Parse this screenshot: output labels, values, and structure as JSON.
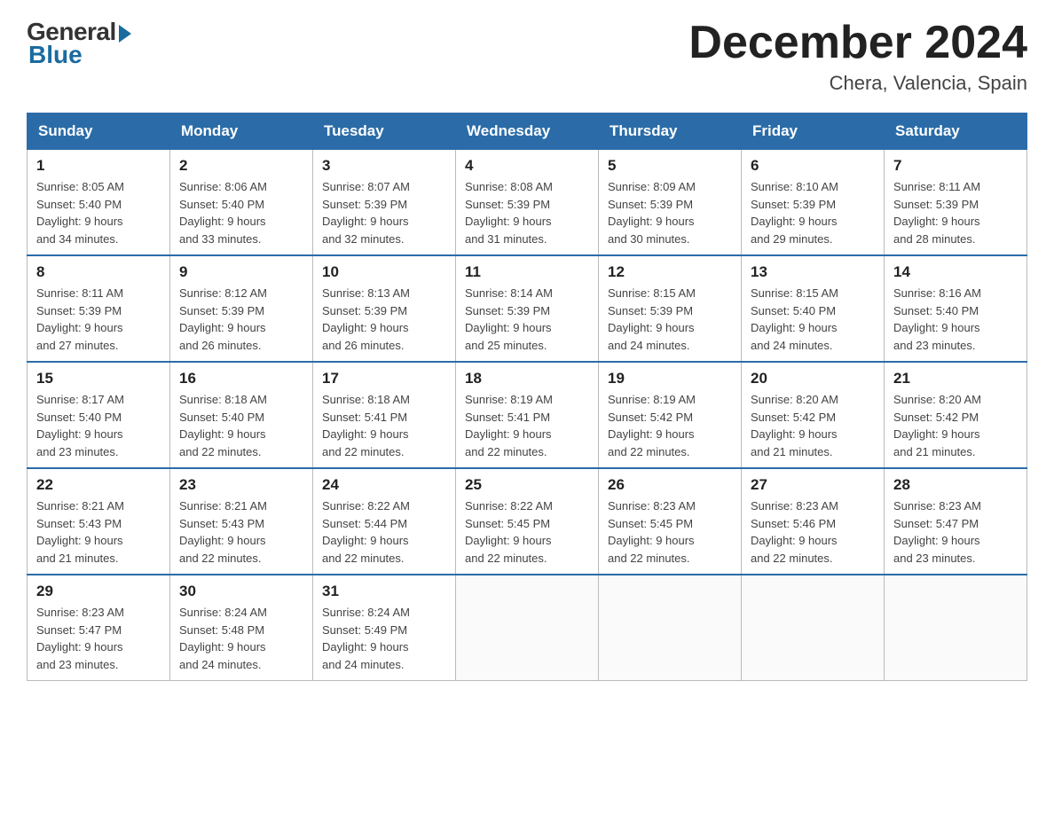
{
  "logo": {
    "general_text": "General",
    "blue_text": "Blue"
  },
  "title": "December 2024",
  "location": "Chera, Valencia, Spain",
  "days_of_week": [
    "Sunday",
    "Monday",
    "Tuesday",
    "Wednesday",
    "Thursday",
    "Friday",
    "Saturday"
  ],
  "weeks": [
    [
      {
        "date": "1",
        "sunrise": "8:05 AM",
        "sunset": "5:40 PM",
        "daylight": "9 hours and 34 minutes."
      },
      {
        "date": "2",
        "sunrise": "8:06 AM",
        "sunset": "5:40 PM",
        "daylight": "9 hours and 33 minutes."
      },
      {
        "date": "3",
        "sunrise": "8:07 AM",
        "sunset": "5:39 PM",
        "daylight": "9 hours and 32 minutes."
      },
      {
        "date": "4",
        "sunrise": "8:08 AM",
        "sunset": "5:39 PM",
        "daylight": "9 hours and 31 minutes."
      },
      {
        "date": "5",
        "sunrise": "8:09 AM",
        "sunset": "5:39 PM",
        "daylight": "9 hours and 30 minutes."
      },
      {
        "date": "6",
        "sunrise": "8:10 AM",
        "sunset": "5:39 PM",
        "daylight": "9 hours and 29 minutes."
      },
      {
        "date": "7",
        "sunrise": "8:11 AM",
        "sunset": "5:39 PM",
        "daylight": "9 hours and 28 minutes."
      }
    ],
    [
      {
        "date": "8",
        "sunrise": "8:11 AM",
        "sunset": "5:39 PM",
        "daylight": "9 hours and 27 minutes."
      },
      {
        "date": "9",
        "sunrise": "8:12 AM",
        "sunset": "5:39 PM",
        "daylight": "9 hours and 26 minutes."
      },
      {
        "date": "10",
        "sunrise": "8:13 AM",
        "sunset": "5:39 PM",
        "daylight": "9 hours and 26 minutes."
      },
      {
        "date": "11",
        "sunrise": "8:14 AM",
        "sunset": "5:39 PM",
        "daylight": "9 hours and 25 minutes."
      },
      {
        "date": "12",
        "sunrise": "8:15 AM",
        "sunset": "5:39 PM",
        "daylight": "9 hours and 24 minutes."
      },
      {
        "date": "13",
        "sunrise": "8:15 AM",
        "sunset": "5:40 PM",
        "daylight": "9 hours and 24 minutes."
      },
      {
        "date": "14",
        "sunrise": "8:16 AM",
        "sunset": "5:40 PM",
        "daylight": "9 hours and 23 minutes."
      }
    ],
    [
      {
        "date": "15",
        "sunrise": "8:17 AM",
        "sunset": "5:40 PM",
        "daylight": "9 hours and 23 minutes."
      },
      {
        "date": "16",
        "sunrise": "8:18 AM",
        "sunset": "5:40 PM",
        "daylight": "9 hours and 22 minutes."
      },
      {
        "date": "17",
        "sunrise": "8:18 AM",
        "sunset": "5:41 PM",
        "daylight": "9 hours and 22 minutes."
      },
      {
        "date": "18",
        "sunrise": "8:19 AM",
        "sunset": "5:41 PM",
        "daylight": "9 hours and 22 minutes."
      },
      {
        "date": "19",
        "sunrise": "8:19 AM",
        "sunset": "5:42 PM",
        "daylight": "9 hours and 22 minutes."
      },
      {
        "date": "20",
        "sunrise": "8:20 AM",
        "sunset": "5:42 PM",
        "daylight": "9 hours and 21 minutes."
      },
      {
        "date": "21",
        "sunrise": "8:20 AM",
        "sunset": "5:42 PM",
        "daylight": "9 hours and 21 minutes."
      }
    ],
    [
      {
        "date": "22",
        "sunrise": "8:21 AM",
        "sunset": "5:43 PM",
        "daylight": "9 hours and 21 minutes."
      },
      {
        "date": "23",
        "sunrise": "8:21 AM",
        "sunset": "5:43 PM",
        "daylight": "9 hours and 22 minutes."
      },
      {
        "date": "24",
        "sunrise": "8:22 AM",
        "sunset": "5:44 PM",
        "daylight": "9 hours and 22 minutes."
      },
      {
        "date": "25",
        "sunrise": "8:22 AM",
        "sunset": "5:45 PM",
        "daylight": "9 hours and 22 minutes."
      },
      {
        "date": "26",
        "sunrise": "8:23 AM",
        "sunset": "5:45 PM",
        "daylight": "9 hours and 22 minutes."
      },
      {
        "date": "27",
        "sunrise": "8:23 AM",
        "sunset": "5:46 PM",
        "daylight": "9 hours and 22 minutes."
      },
      {
        "date": "28",
        "sunrise": "8:23 AM",
        "sunset": "5:47 PM",
        "daylight": "9 hours and 23 minutes."
      }
    ],
    [
      {
        "date": "29",
        "sunrise": "8:23 AM",
        "sunset": "5:47 PM",
        "daylight": "9 hours and 23 minutes."
      },
      {
        "date": "30",
        "sunrise": "8:24 AM",
        "sunset": "5:48 PM",
        "daylight": "9 hours and 24 minutes."
      },
      {
        "date": "31",
        "sunrise": "8:24 AM",
        "sunset": "5:49 PM",
        "daylight": "9 hours and 24 minutes."
      },
      null,
      null,
      null,
      null
    ]
  ],
  "labels": {
    "sunrise": "Sunrise:",
    "sunset": "Sunset:",
    "daylight": "Daylight:"
  }
}
